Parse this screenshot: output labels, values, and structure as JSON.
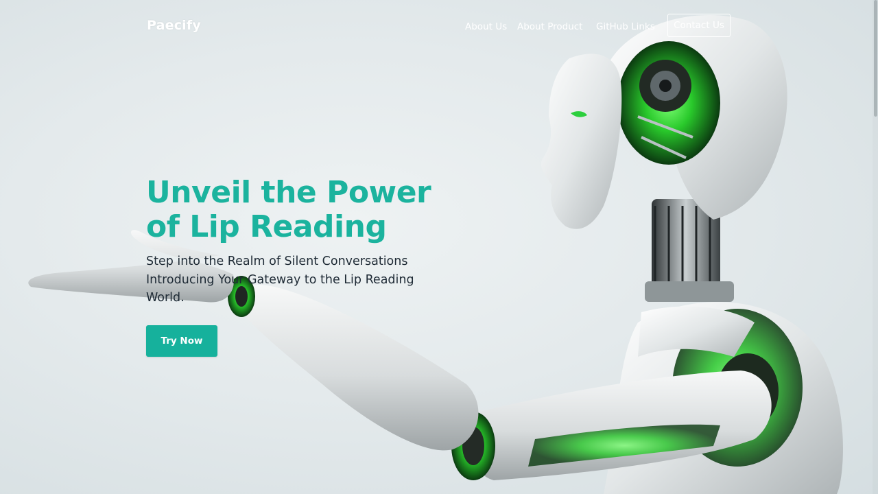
{
  "nav": {
    "brand": "Paecify",
    "links": [
      "About Us",
      "About Product",
      "GitHub Links"
    ],
    "contact": "Contact Us"
  },
  "hero": {
    "title_line1": "Unveil the Power",
    "title_line2": "of Lip Reading",
    "subtitle_line1": "Step into the Realm of Silent Conversations",
    "subtitle_line2": "Introducing Your Gateway to the Lip Reading",
    "subtitle_line3": "World.",
    "cta": "Try Now"
  },
  "colors": {
    "accent": "#1bb39e",
    "button": "#16b19c",
    "text_dark": "#1e2a35",
    "background": "#e4eaec"
  },
  "icons": {
    "hero_image": "humanoid-robot-illustration"
  }
}
